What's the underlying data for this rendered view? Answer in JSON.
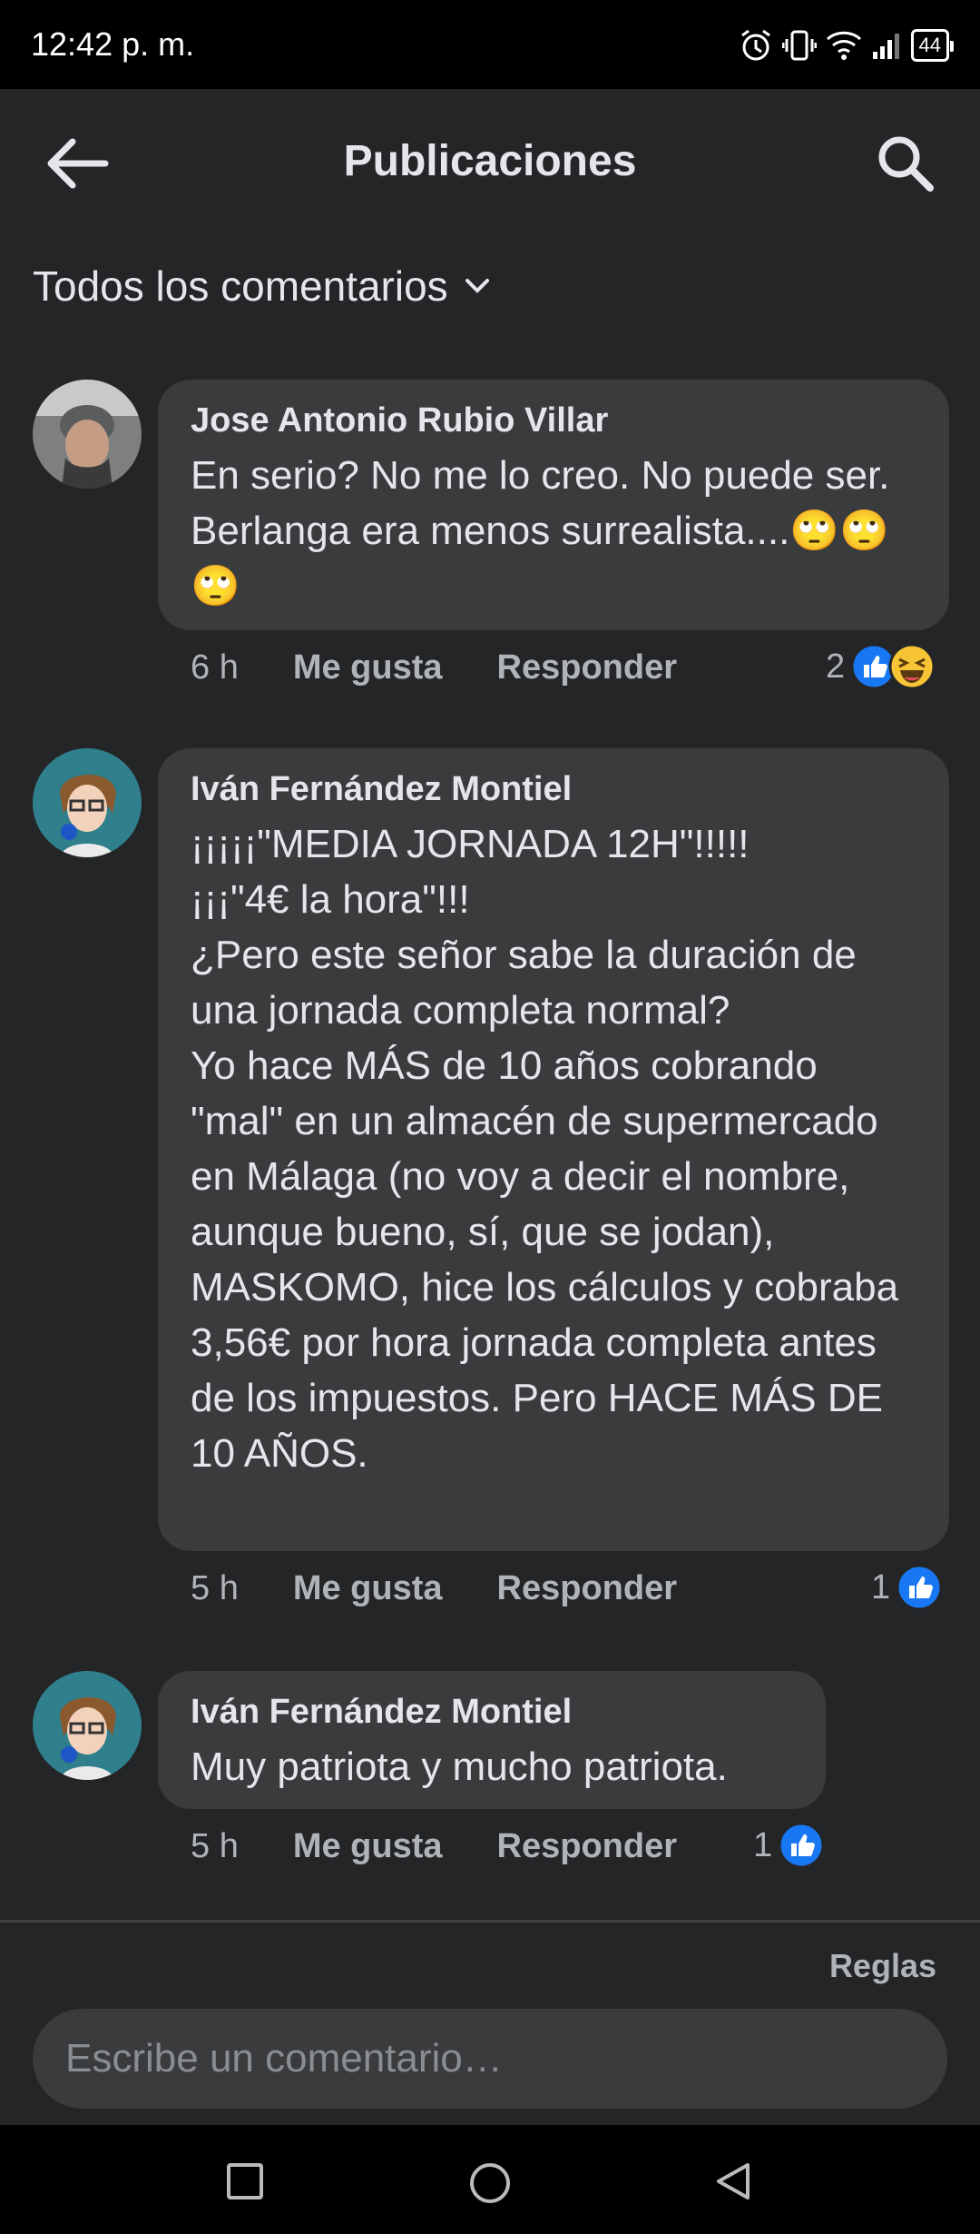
{
  "status_bar": {
    "time": "12:42 p. m.",
    "battery": "44"
  },
  "header": {
    "title": "Publicaciones"
  },
  "filter": {
    "label": "Todos los comentarios"
  },
  "comments": [
    {
      "author": "Jose Antonio Rubio Villar",
      "text": "En serio? No me lo creo. No puede ser. Berlanga era menos surrealista....🙄🙄🙄",
      "time": "6 h",
      "like_label": "Me gusta",
      "reply_label": "Responder",
      "reaction_count": "2",
      "reactions": [
        "like-icon",
        "haha-icon"
      ]
    },
    {
      "author": "Iván Fernández Montiel",
      "text": "¡¡¡¡¡\"MEDIA JORNADA 12H\"!!!!!\n¡¡¡\"4€ la hora\"!!!\n¿Pero este señor sabe la duración de una jornada completa normal?\nYo hace MÁS de 10 años cobrando \"mal\" en un almacén de supermercado en Málaga (no voy a decir el nombre, aunque bueno, sí, que se jodan), MASKOMO, hice los cálculos y cobraba 3,56€ por hora jornada completa antes de los impuestos. Pero HACE MÁS DE 10 AÑOS.",
      "time": "5 h",
      "like_label": "Me gusta",
      "reply_label": "Responder",
      "reaction_count": "1",
      "reactions": [
        "like-icon"
      ]
    },
    {
      "author": "Iván Fernández Montiel",
      "text": "Muy patriota y mucho patriota.",
      "time": "5 h",
      "like_label": "Me gusta",
      "reply_label": "Responder",
      "reaction_count": "1",
      "reactions": [
        "like-icon"
      ]
    }
  ],
  "footer": {
    "rules_label": "Reglas",
    "composer_placeholder": "Escribe un comentario…"
  },
  "colors": {
    "background": "#242526",
    "bubble": "#3a3b3c",
    "accent": "#1877f2"
  }
}
